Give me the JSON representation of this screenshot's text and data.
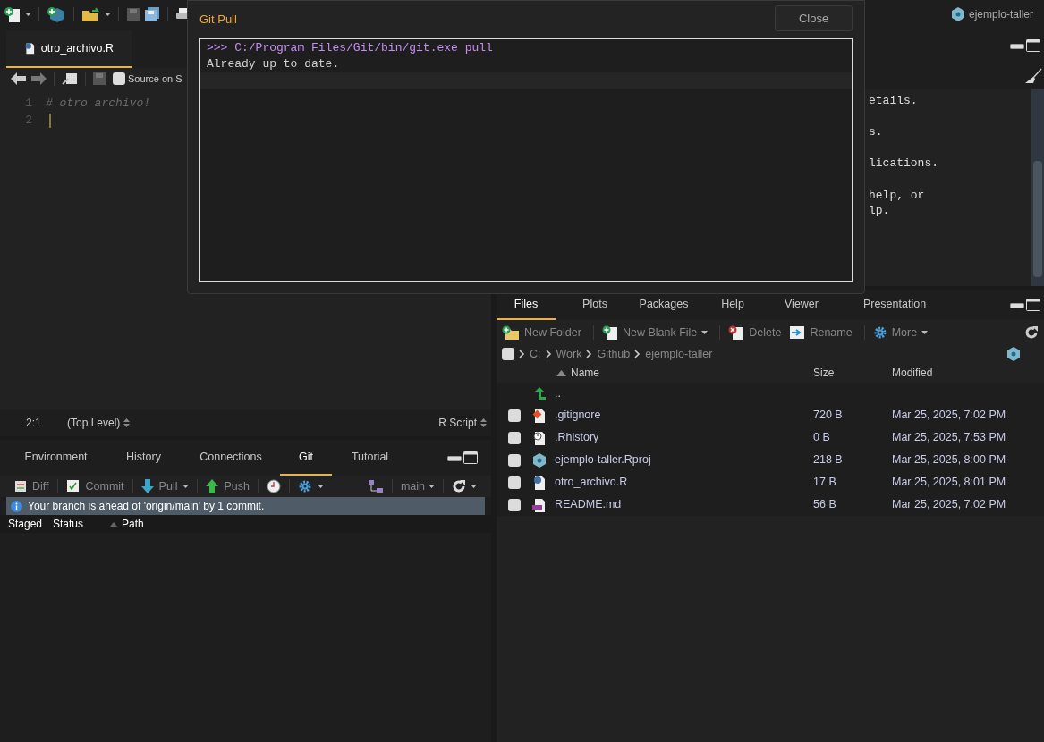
{
  "toolbar": {
    "project": "ejemplo-taller"
  },
  "editor": {
    "tabs": [
      {
        "label": "otro_archivo.R",
        "selected": true
      }
    ],
    "source_on_save": {
      "label": "Source on S",
      "checked": false
    },
    "lines": [
      {
        "number": "1",
        "code": "# otro archivo!"
      },
      {
        "number": "2"
      }
    ],
    "status": {
      "position": "2:1",
      "scope": "(Top Level)",
      "file_type": "R Script"
    }
  },
  "console": {
    "paragraphs": [
      [
        "etails."
      ],
      [
        "s."
      ],
      [
        "lications."
      ],
      [
        "help, or",
        "lp."
      ]
    ]
  },
  "git_panel": {
    "tabs": [
      {
        "label": "Environment",
        "selected": false
      },
      {
        "label": "History",
        "selected": false
      },
      {
        "label": "Connections",
        "selected": false
      },
      {
        "label": "Git",
        "selected": true
      },
      {
        "label": "Tutorial",
        "selected": false
      }
    ],
    "toolbar": [
      {
        "kind": "diff",
        "label": "Diff"
      },
      {
        "kind": "commit",
        "label": "Commit"
      },
      {
        "kind": "pull",
        "label": "Pull"
      },
      {
        "kind": "push",
        "label": "Push"
      },
      {
        "kind": "history"
      },
      {
        "kind": "settings"
      }
    ],
    "branch": "main",
    "notice": "Your branch is ahead of 'origin/main' by 1 commit.",
    "columns": [
      "Staged",
      "Status",
      "Path"
    ]
  },
  "files_panel": {
    "tabs": [
      {
        "label": "Files",
        "selected": true
      },
      {
        "label": "Plots",
        "selected": false
      },
      {
        "label": "Packages",
        "selected": false
      },
      {
        "label": "Help",
        "selected": false
      },
      {
        "label": "Viewer",
        "selected": false
      },
      {
        "label": "Presentation",
        "selected": false
      }
    ],
    "toolbar": [
      {
        "kind": "new_folder",
        "label": "New Folder"
      },
      {
        "kind": "new_file",
        "label": "New Blank File"
      },
      {
        "kind": "delete",
        "label": "Delete"
      },
      {
        "kind": "rename",
        "label": "Rename"
      },
      {
        "kind": "more",
        "label": "More"
      }
    ],
    "select_all": {
      "checked": false
    },
    "breadcrumb": [
      "C:",
      "Work",
      "Github",
      "ejemplo-taller"
    ],
    "columns": [
      "Name",
      "Size",
      "Modified"
    ],
    "parent": "..",
    "rows": [
      {
        "kind": "git",
        "name": ".gitignore",
        "size": "720 B",
        "modified": "Mar 25, 2025, 7:02 PM",
        "checked": false
      },
      {
        "kind": "history",
        "name": ".Rhistory",
        "size": "0 B",
        "modified": "Mar 25, 2025, 7:53 PM",
        "checked": false
      },
      {
        "kind": "rproj",
        "name": "ejemplo-taller.Rproj",
        "size": "218 B",
        "modified": "Mar 25, 2025, 8:00 PM",
        "checked": false
      },
      {
        "kind": "r",
        "name": "otro_archivo.R",
        "size": "17 B",
        "modified": "Mar 25, 2025, 8:01 PM",
        "checked": false
      },
      {
        "kind": "md",
        "name": "README.md",
        "size": "56 B",
        "modified": "Mar 25, 2025, 7:02 PM",
        "checked": false
      }
    ]
  },
  "dialog": {
    "title": "Git Pull",
    "close": "Close",
    "output": [
      {
        "kind": "command",
        "text": ">>> C:/Program Files/Git/bin/git.exe pull"
      },
      {
        "kind": "output",
        "text": "Already up to date."
      }
    ]
  }
}
